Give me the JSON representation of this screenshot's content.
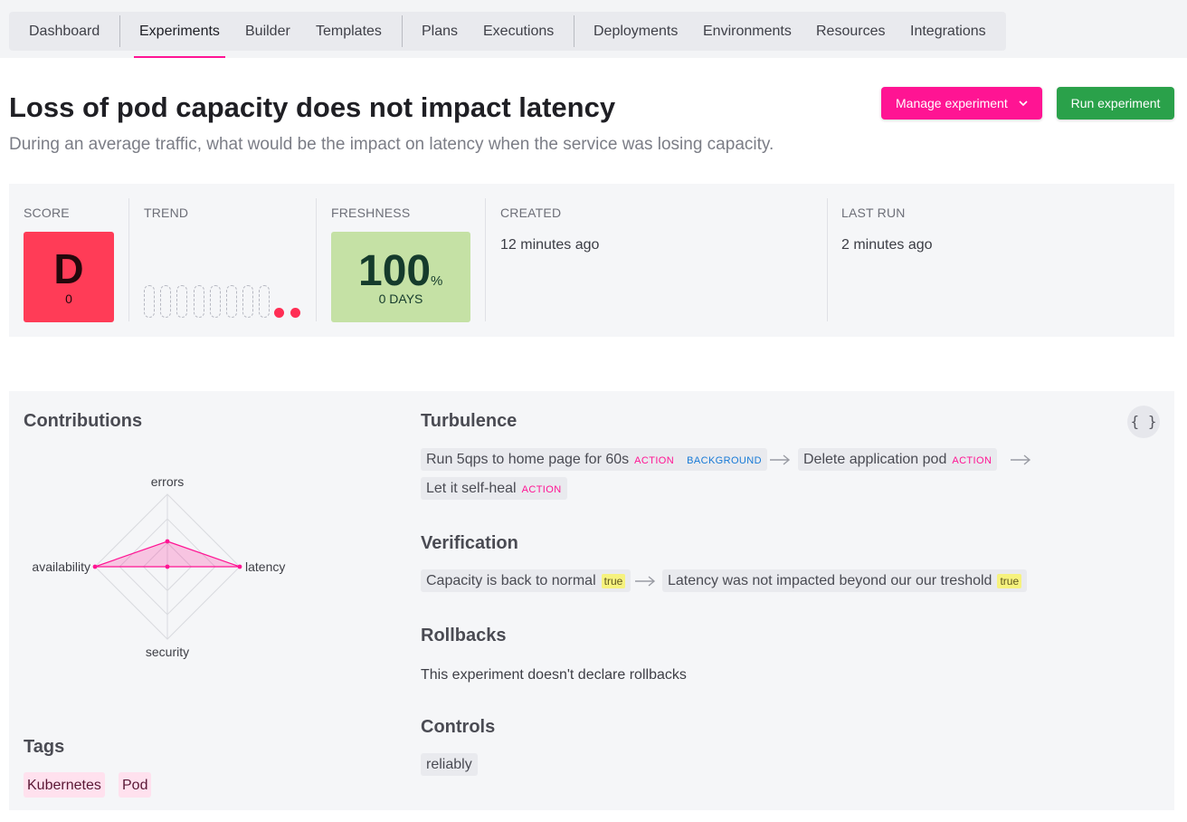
{
  "nav": {
    "items": [
      "Dashboard",
      "Experiments",
      "Builder",
      "Templates",
      "Plans",
      "Executions",
      "Deployments",
      "Environments",
      "Resources",
      "Integrations"
    ],
    "active": "Experiments"
  },
  "experiment": {
    "title": "Loss of pod capacity does not impact latency",
    "description": "During an average traffic, what would be the impact on latency when the service was losing capacity."
  },
  "actions": {
    "manage_label": "Manage experiment",
    "run_label": "Run experiment",
    "manage_color": "#ff1493",
    "run_color": "#2aa14a"
  },
  "stats": {
    "score_label": "SCORE",
    "score_grade": "D",
    "score_value": "0",
    "trend_label": "TREND",
    "trend": {
      "empty_slots": 8,
      "failed_runs": 2
    },
    "freshness_label": "FRESHNESS",
    "freshness_value": "100",
    "freshness_unit": "%",
    "freshness_days": "0 DAYS",
    "created_label": "CREATED",
    "created_value": "12 minutes ago",
    "last_run_label": "LAST RUN",
    "last_run_value": "2 minutes ago"
  },
  "contributions": {
    "title": "Contributions",
    "axes": [
      "errors",
      "latency",
      "security",
      "availability"
    ],
    "values": [
      0.35,
      1.0,
      0.0,
      1.0
    ]
  },
  "tags": {
    "title": "Tags",
    "items": [
      "Kubernetes",
      "Pod"
    ]
  },
  "json_button": "{ }",
  "turbulence": {
    "title": "Turbulence",
    "steps": [
      {
        "label": "Run 5qps to home page for 60s",
        "badges": [
          "ACTION",
          "BACKGROUND"
        ]
      },
      {
        "label": "Delete application pod",
        "badges": [
          "ACTION"
        ]
      },
      {
        "label": "Let it self-heal",
        "badges": [
          "ACTION"
        ]
      }
    ]
  },
  "verification": {
    "title": "Verification",
    "steps": [
      {
        "label": "Capacity is back to normal",
        "badge": "true"
      },
      {
        "label": "Latency was not impacted beyond our our treshold",
        "badge": "true"
      }
    ]
  },
  "rollbacks": {
    "title": "Rollbacks",
    "text": "This experiment doesn't declare rollbacks"
  },
  "controls": {
    "title": "Controls",
    "items": [
      "reliably"
    ]
  }
}
